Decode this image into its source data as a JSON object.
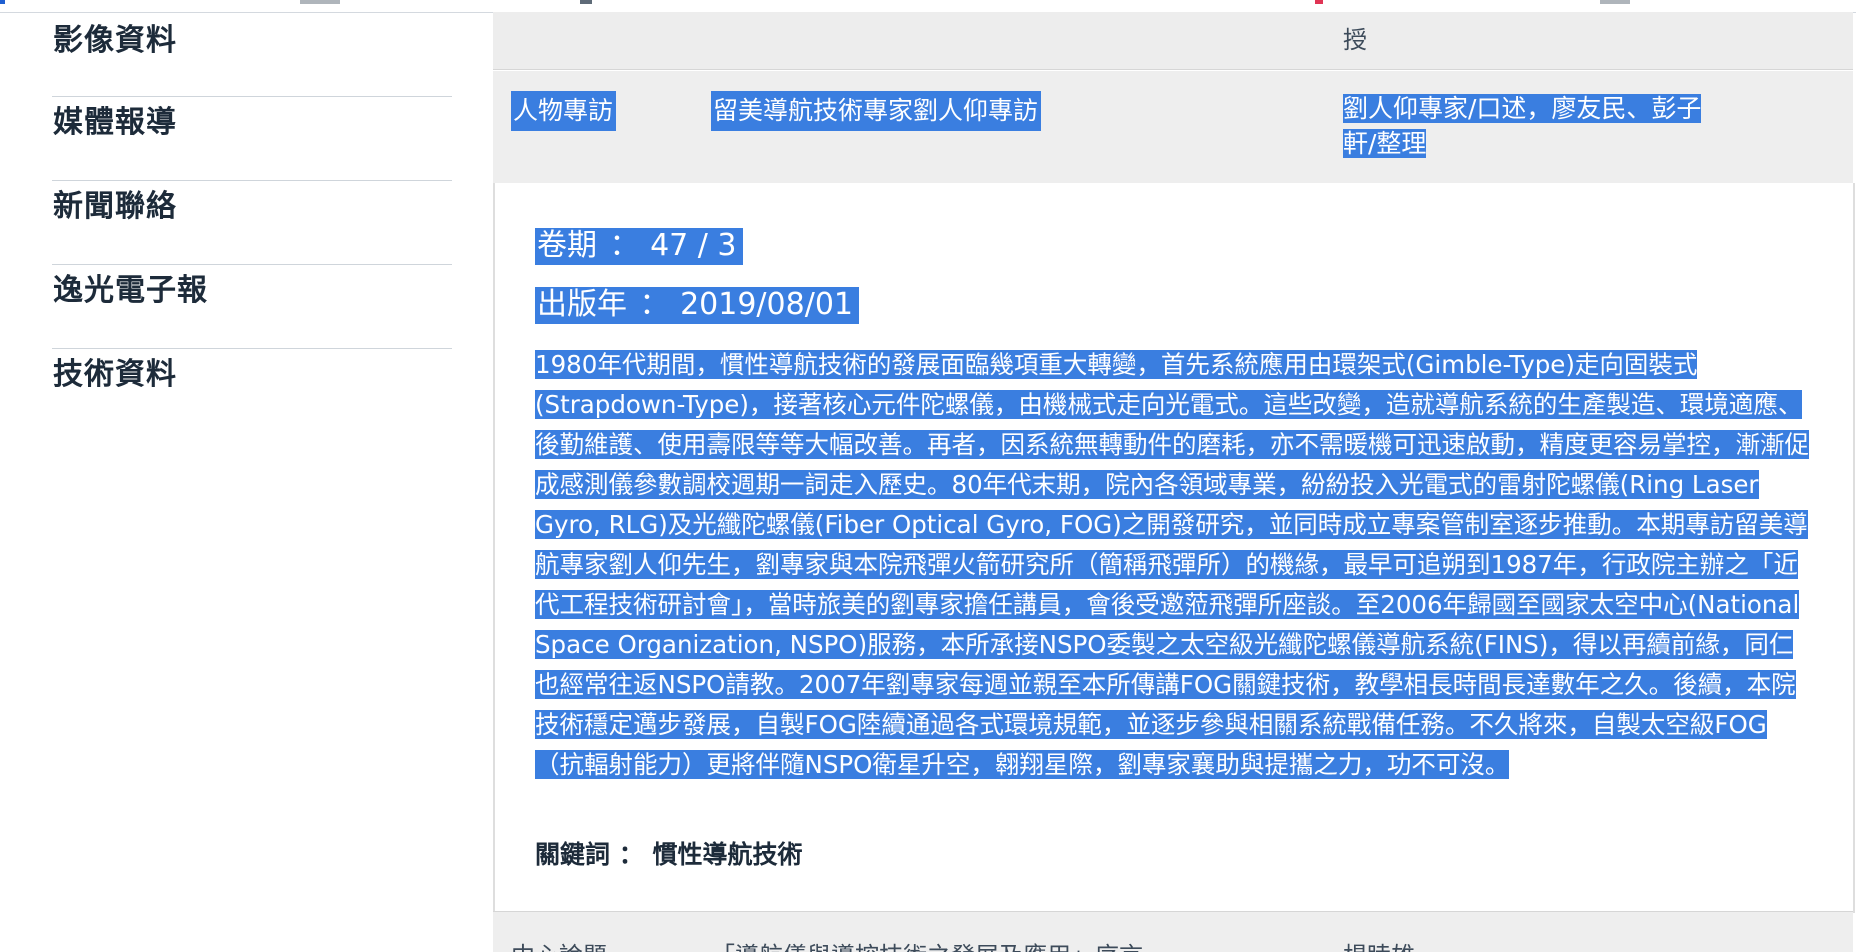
{
  "sidebar": {
    "items": [
      {
        "label": "影像資料"
      },
      {
        "label": "媒體報導"
      },
      {
        "label": "新聞聯絡"
      },
      {
        "label": "逸光電子報"
      },
      {
        "label": "技術資料"
      }
    ]
  },
  "list": {
    "row_top": {
      "author_fragment": "授"
    },
    "row_selected": {
      "category": "人物專訪",
      "title": "留美導航技術專家劉人仰專訪",
      "author": "劉人仰專家/口述，廖友民、彭子軒/整理"
    },
    "detail": {
      "volume_label": "卷期",
      "volume_value": "47 / 3",
      "year_label": "出版年",
      "year_value": "2019/08/01",
      "abstract": "1980年代期間，慣性導航技術的發展面臨幾項重大轉變，首先系統應用由環架式(Gimble-Type)走向固裝式(Strapdown-Type)，接著核心元件陀螺儀，由機械式走向光電式。這些改變，造就導航系統的生產製造、環境適應、後勤維護、使用壽限等等大幅改善。再者，因系統無轉動件的磨耗，亦不需暖機可迅速啟動，精度更容易掌控，漸漸促成感測儀參數調校週期一詞走入歷史。80年代末期，院內各領域專業，紛紛投入光電式的雷射陀螺儀(Ring Laser Gyro, RLG)及光纖陀螺儀(Fiber Optical Gyro, FOG)之開發研究，並同時成立專案管制室逐步推動。本期專訪留美導航專家劉人仰先生，劉專家與本院飛彈火箭研究所（簡稱飛彈所）的機緣，最早可追朔到1987年，行政院主辦之「近代工程技術研討會」，當時旅美的劉專家擔任講員，會後受邀蒞飛彈所座談。至2006年歸國至國家太空中心(National Space Organization, NSPO)服務，本所承接NSPO委製之太空級光纖陀螺儀導航系統(FINS)，得以再續前緣，同仁也經常往返NSPO請教。2007年劉專家每週並親至本所傳講FOG關鍵技術，教學相長時間長達數年之久。後續，本院技術穩定邁步發展，自製FOG陸續通過各式環境規範，並逐步參與相關系統戰備任務。不久將來，自製太空級FOG（抗輻射能力）更將伴隨NSPO衛星升空，翱翔星際，劉專家襄助與提攜之力，功不可沒。",
      "keyword_label": "關鍵詞",
      "keyword_value": "慣性導航技術"
    },
    "row_bottom": {
      "category": "中心論題",
      "title": "「導航儀與導控技術之發展及應用」序言",
      "author": "楊睦雄"
    }
  },
  "colors": {
    "selection": "#3a7ee0",
    "text": "#1d2b3a",
    "row_background": "#eeeeee"
  }
}
